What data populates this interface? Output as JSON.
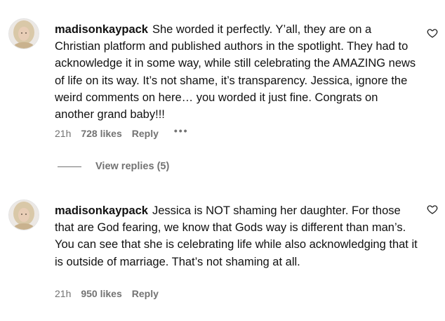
{
  "comments": [
    {
      "username": "madisonkaypack",
      "text": "She worded it perfectly. Y’all, they are on a Christian platform and published authors in the spotlight. They had to acknowledge it in some way, while still celebrating the AMAZING news of life on its way. It’s not shame, it’s transparency. Jessica, ignore the weird comments on here… you worded it just fine. Congrats on another grand baby!!!",
      "time": "21h",
      "likes": "728 likes",
      "reply_label": "Reply",
      "more_label": "•••",
      "view_replies": "View replies (5)"
    },
    {
      "username": "madisonkaypack",
      "text": "Jessica is NOT shaming her daughter. For those that are God fearing, we know that Gods way is different than man’s. You can see that she is celebrating life while also acknowledging that it is outside of marriage. That’s not shaming at all.",
      "time": "21h",
      "likes": "950 likes",
      "reply_label": "Reply"
    }
  ],
  "icons": {
    "like": "heart-icon",
    "avatar": "avatar",
    "more": "more-options-icon"
  },
  "colors": {
    "text": "#111111",
    "meta": "#737373",
    "background": "#ffffff"
  }
}
